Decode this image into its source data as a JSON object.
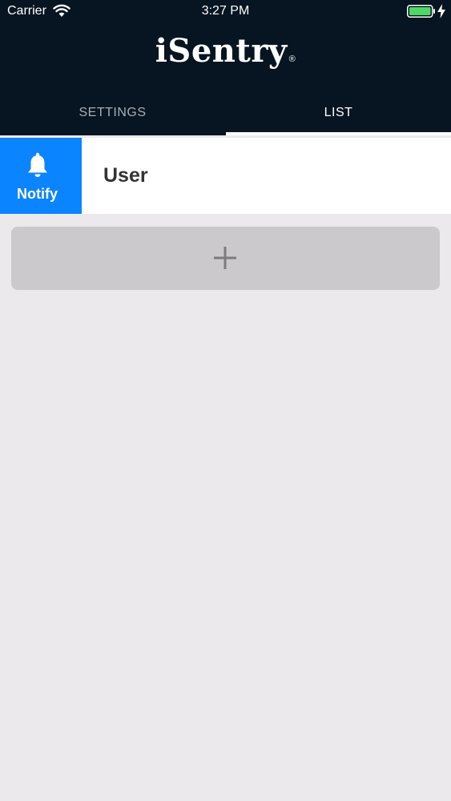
{
  "status_bar": {
    "carrier": "Carrier",
    "time": "3:27 PM"
  },
  "header": {
    "logo_text": "iSentry",
    "logo_mark": "®",
    "background_color": "#071422"
  },
  "tabs": [
    {
      "label": "SETTINGS",
      "selected": false
    },
    {
      "label": "LIST",
      "selected": true
    }
  ],
  "list": {
    "rows": [
      {
        "title": "User",
        "swipe_action": {
          "label": "Notify",
          "icon": "bell-icon",
          "color": "#0a84ff"
        }
      }
    ],
    "add_button_icon": "plus-icon"
  }
}
